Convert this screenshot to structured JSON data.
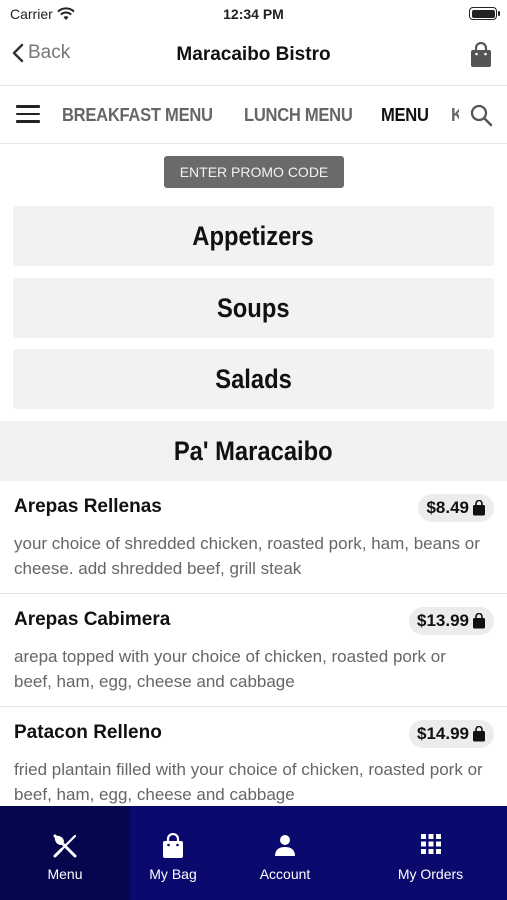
{
  "status": {
    "carrier": "Carrier",
    "time": "12:34 PM"
  },
  "nav": {
    "back_label": "Back",
    "title": "Maracaibo Bistro"
  },
  "tabs": [
    "BREAKFAST MENU",
    "LUNCH MENU",
    "MENU",
    "KIDS M"
  ],
  "active_tab": "MENU",
  "promo": {
    "label": "ENTER PROMO CODE"
  },
  "categories": [
    "Appetizers",
    "Soups",
    "Salads"
  ],
  "section": {
    "title": "Pa' Maracaibo"
  },
  "items": [
    {
      "name": "Arepas Rellenas",
      "price": "$8.49",
      "description": "your choice of shredded chicken, roasted pork, ham, beans or cheese. add shredded beef, grill steak"
    },
    {
      "name": "Arepas Cabimera",
      "price": "$13.99",
      "description": "arepa topped with your choice of chicken, roasted pork or beef, ham, egg, cheese and cabbage"
    },
    {
      "name": "Patacon Relleno",
      "price": "$14.99",
      "description": "fried plantain filled with your choice of chicken, roasted pork or beef, ham, egg, cheese and cabbage"
    }
  ],
  "bottom_tabs": [
    {
      "label": "Menu",
      "icon": "fork-knife-icon"
    },
    {
      "label": "My Bag",
      "icon": "bag-icon"
    },
    {
      "label": "Account",
      "icon": "person-icon"
    },
    {
      "label": "My Orders",
      "icon": "grid-icon"
    }
  ],
  "colors": {
    "bottom_bar": "#0a0a6e",
    "promo_bg": "#6a6a6a",
    "category_bg": "#f2f2f2"
  }
}
